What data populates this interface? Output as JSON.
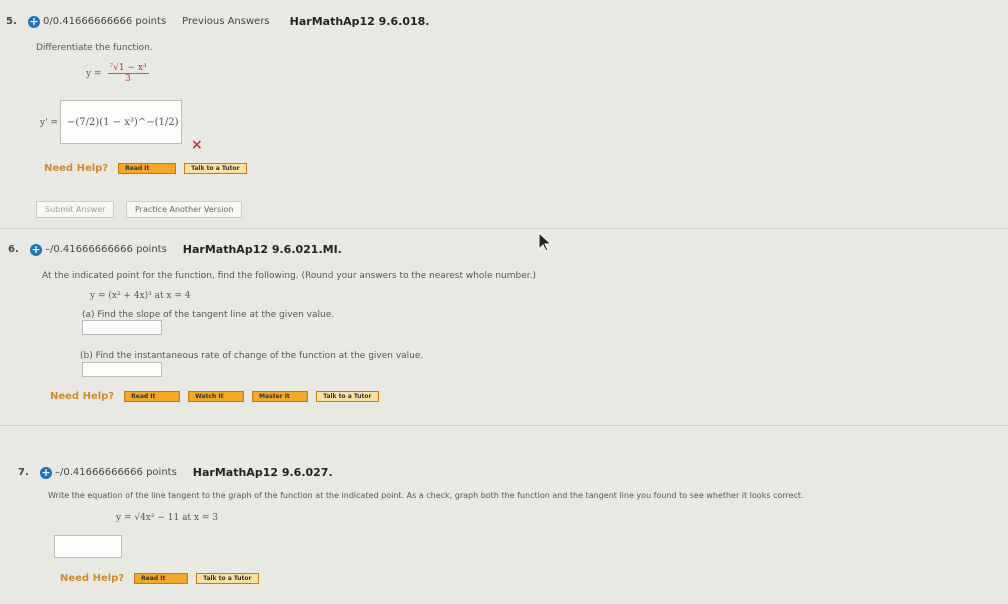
{
  "q5": {
    "number": "5.",
    "points": "0/0.41666666666 points",
    "previous": "Previous Answers",
    "id": "HarMathAp12 9.6.018.",
    "instruction": "Differentiate the function.",
    "y_label": "y =",
    "numer": "⁷√1 − x³",
    "denom": "3",
    "yprime_label": "y' =",
    "answer": "−(7/2)(1 − x³)^−(1/2)",
    "wrong_mark": "×",
    "need_help": "Need Help?",
    "buttons": [
      "Read It",
      "Talk to a Tutor"
    ],
    "submit": "Submit Answer",
    "practice": "Practice Another Version"
  },
  "q6": {
    "number": "6.",
    "points": "–/0.41666666666 points",
    "id": "HarMathAp12 9.6.021.MI.",
    "instruction": "At the indicated point for the function, find the following. (Round your answers to the nearest whole number.)",
    "equation": "y = (x² + 4x)³ at x = 4",
    "part_a": "(a) Find the slope of the tangent line at the given value.",
    "part_b": "(b) Find the instantaneous rate of change of the function at the given value.",
    "need_help": "Need Help?",
    "buttons": [
      "Read It",
      "Watch It",
      "Master It",
      "Talk to a Tutor"
    ]
  },
  "q7": {
    "number": "7.",
    "points": "–/0.41666666666 points",
    "id": "HarMathAp12 9.6.027.",
    "instruction": "Write the equation of the line tangent to the graph of the function at the indicated point. As a check, graph both the function and the tangent line you found to see whether it looks correct.",
    "equation": "y = √4x² − 11 at x = 3",
    "need_help": "Need Help?",
    "buttons": [
      "Read It",
      "Talk to a Tutor"
    ]
  },
  "colors": {
    "accent": "#1b74b8",
    "help": "#d08a2a",
    "button": "#f5a623",
    "error": "#d32f2f"
  }
}
